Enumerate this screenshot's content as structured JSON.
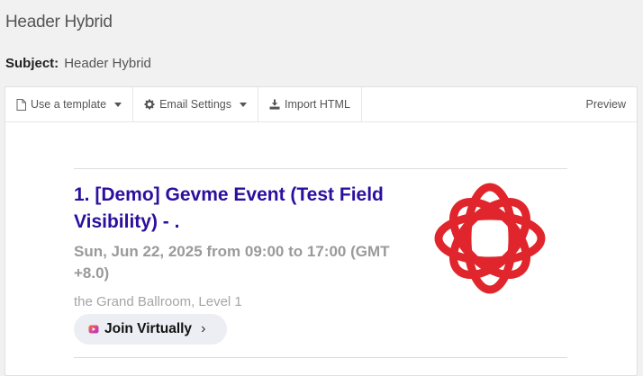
{
  "page": {
    "title": "Header Hybrid"
  },
  "subject": {
    "label": "Subject:",
    "value": "Header Hybrid"
  },
  "toolbar": {
    "template_label": "Use a template",
    "settings_label": "Email Settings",
    "import_label": "Import HTML",
    "preview_label": "Preview"
  },
  "event": {
    "title": "1. [Demo] Gevme Event (Test Field Visibility) - .",
    "date": "Sun, Jun 22, 2025 from 09:00 to 17:00 (GMT +8.0)",
    "venue": "the Grand Ballroom, Level 1",
    "join_label": "Join Virtually",
    "join_chevron": "›",
    "logo_icon": "interlocking-rings-logo",
    "colors": {
      "title": "#2b0f9e",
      "logo": "#e0262c"
    }
  }
}
